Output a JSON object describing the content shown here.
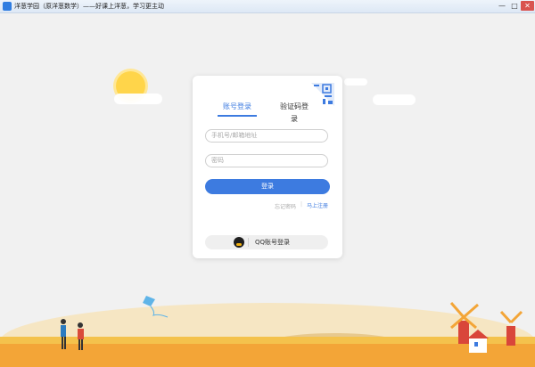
{
  "window": {
    "title": "洋葱学园（原洋葱数学）——好课上洋葱，学习更主动",
    "controls": {
      "minimize": "—",
      "maximize": "□",
      "close": "✕"
    }
  },
  "login": {
    "tabs": [
      "账号登录",
      "验证码登录"
    ],
    "active_tab": 0,
    "phone_placeholder": "手机号/邮箱地址",
    "password_placeholder": "密码",
    "login_button": "登录",
    "forgot_password": "忘记密码",
    "divider": "|",
    "register": "马上注册",
    "qq_login": "QQ账号登录"
  },
  "colors": {
    "accent": "#3d7be0",
    "background": "#f1f1f1",
    "card": "#ffffff",
    "close_button": "#d9534f"
  },
  "icons": [
    "app-icon",
    "qr-code-icon",
    "qq-icon",
    "sun-icon"
  ]
}
